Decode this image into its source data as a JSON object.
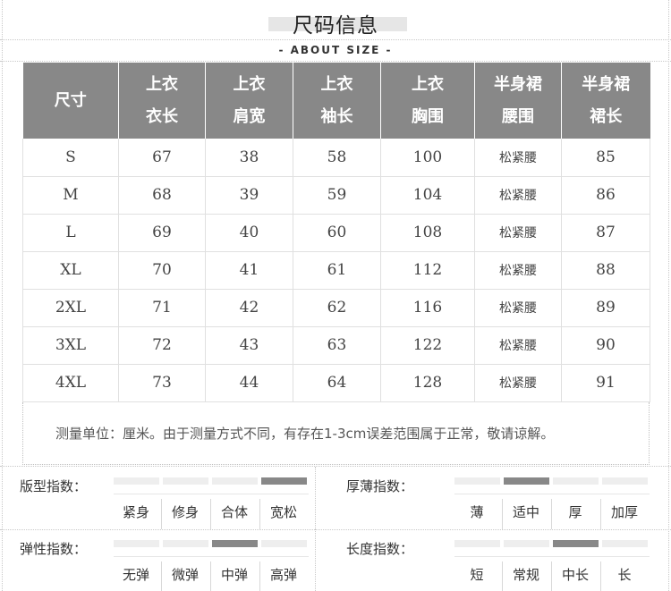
{
  "title": "尺码信息",
  "subtitle": "- ABOUT SIZE -",
  "headers": [
    {
      "l1": "尺寸",
      "l2": ""
    },
    {
      "l1": "上衣",
      "l2": "衣长"
    },
    {
      "l1": "上衣",
      "l2": "肩宽"
    },
    {
      "l1": "上衣",
      "l2": "袖长"
    },
    {
      "l1": "上衣",
      "l2": "胸围"
    },
    {
      "l1": "半身裙",
      "l2": "腰围"
    },
    {
      "l1": "半身裙",
      "l2": "裙长"
    }
  ],
  "rows": [
    [
      "S",
      "67",
      "38",
      "58",
      "100",
      "松紧腰",
      "85"
    ],
    [
      "M",
      "68",
      "39",
      "59",
      "104",
      "松紧腰",
      "86"
    ],
    [
      "L",
      "69",
      "40",
      "60",
      "108",
      "松紧腰",
      "87"
    ],
    [
      "XL",
      "70",
      "41",
      "61",
      "112",
      "松紧腰",
      "88"
    ],
    [
      "2XL",
      "71",
      "42",
      "62",
      "116",
      "松紧腰",
      "89"
    ],
    [
      "3XL",
      "72",
      "43",
      "63",
      "122",
      "松紧腰",
      "90"
    ],
    [
      "4XL",
      "73",
      "44",
      "64",
      "128",
      "松紧腰",
      "91"
    ]
  ],
  "note": "测量单位：厘米。由于测量方式不同，有存在1-3cm误差范围属于正常，敬请谅解。",
  "indices": {
    "fit": {
      "label": "版型指数：",
      "options": [
        "紧身",
        "修身",
        "合体",
        "宽松"
      ],
      "selected": 3
    },
    "thickness": {
      "label": "厚薄指数：",
      "options": [
        "薄",
        "适中",
        "厚",
        "加厚"
      ],
      "selected": 1
    },
    "elasticity": {
      "label": "弹性指数：",
      "options": [
        "无弹",
        "微弹",
        "中弹",
        "高弹"
      ],
      "selected": 2
    },
    "length": {
      "label": "长度指数：",
      "options": [
        "短",
        "常规",
        "中长",
        "长"
      ],
      "selected": 2
    }
  },
  "colors": {
    "header_bg": "#888888",
    "active_segment": "#888888",
    "inactive_segment": "#eeeeee"
  }
}
